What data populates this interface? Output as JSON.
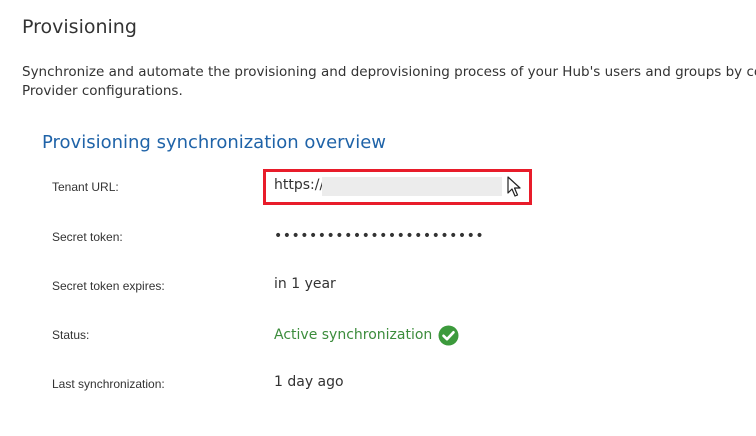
{
  "page": {
    "title": "Provisioning",
    "description_line1": "Synchronize and automate the provisioning and deprovisioning process of your Hub's users and groups by confi",
    "description_line2": "Provider configurations."
  },
  "overview": {
    "title": "Provisioning synchronization overview",
    "tenant_url": {
      "label": "Tenant URL:",
      "prefix": "https://"
    },
    "secret_token": {
      "label": "Secret token:",
      "value": "••••••••••••••••••••••••"
    },
    "secret_expires": {
      "label": "Secret token expires:",
      "value": "in 1 year"
    },
    "status": {
      "label": "Status:",
      "value": "Active synchronization"
    },
    "last_sync": {
      "label": "Last synchronization:",
      "value": "1 day ago"
    }
  },
  "icons": {
    "status": "check-circle-icon",
    "cursor": "mouse-pointer-icon"
  },
  "colors": {
    "section_title": "#1f63a8",
    "status_active": "#3c8c3c",
    "highlight_box": "#e81c2a"
  }
}
